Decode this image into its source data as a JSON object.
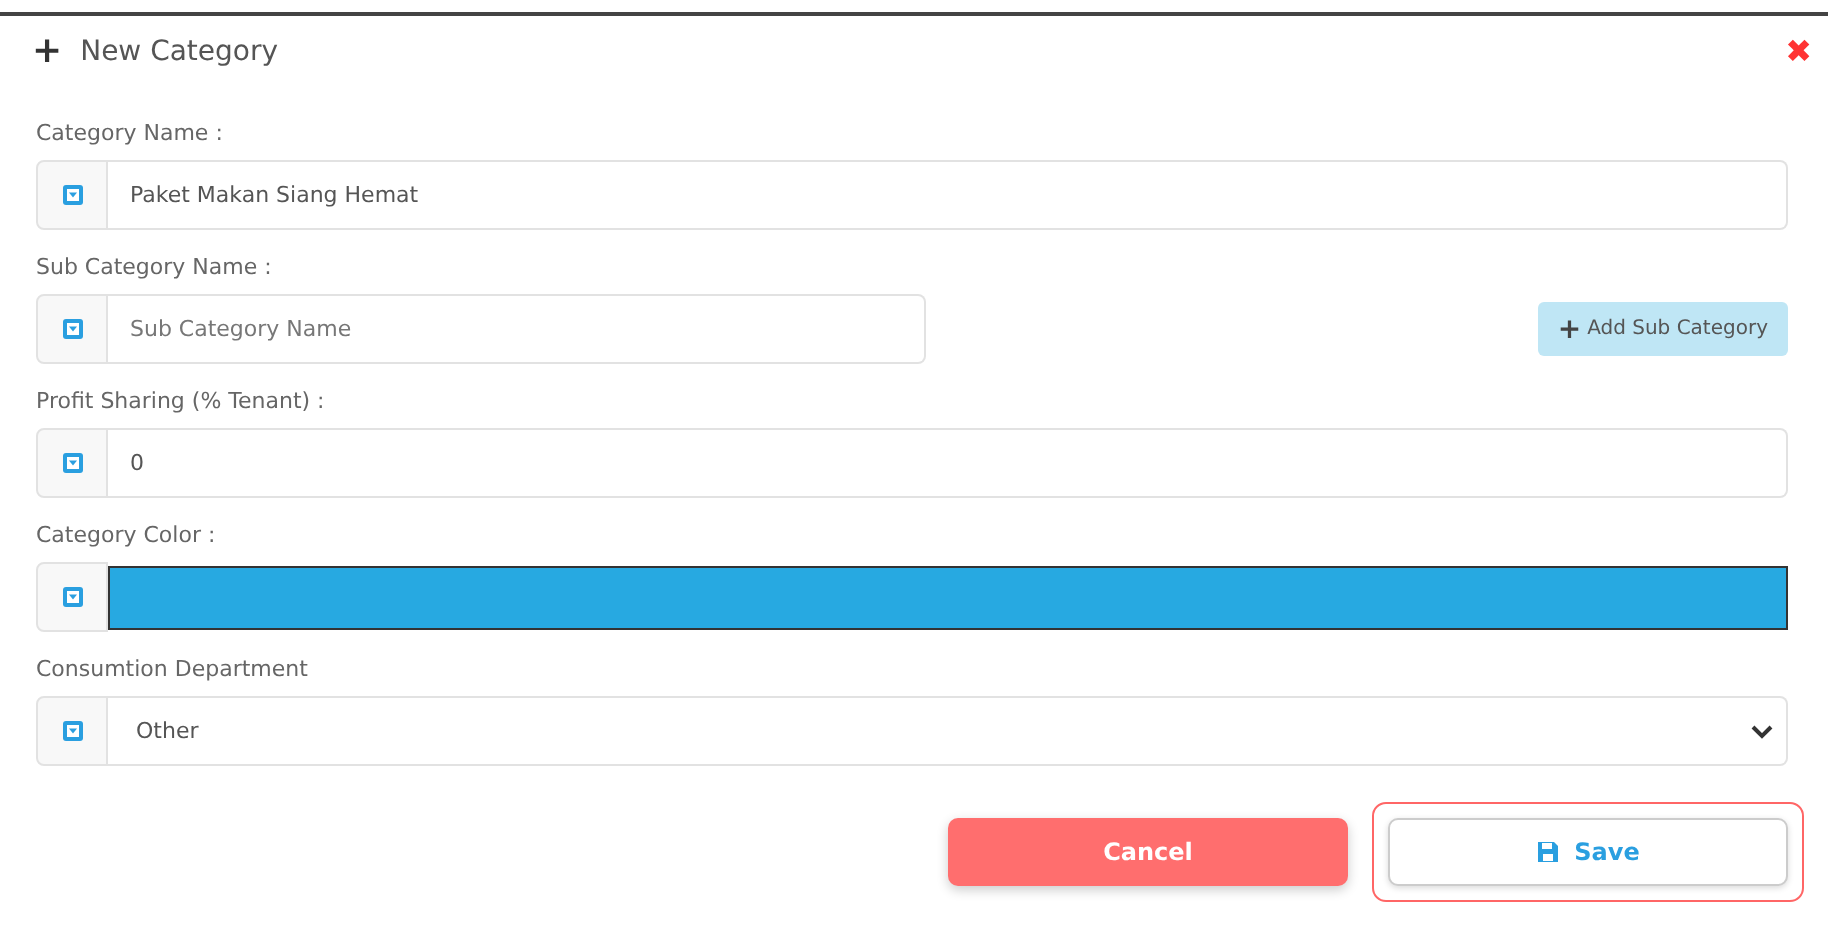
{
  "dialog": {
    "title": "New Category",
    "title_icon": "+",
    "close_icon": "✖"
  },
  "fields": [
    {
      "kind": "text",
      "label": "Category Name :",
      "value": "Paket Makan Siang Hemat"
    },
    {
      "kind": "text",
      "label": "Sub Category Name :",
      "placeholder": "Sub Category Name",
      "button": {
        "icon": "+",
        "label": "Add Sub Category"
      }
    },
    {
      "kind": "text",
      "label": "Profit Sharing (% Tenant) :",
      "value": "0"
    },
    {
      "kind": "color",
      "label": "Category Color :",
      "color": "#27a9e1"
    },
    {
      "kind": "select",
      "label": "Consumtion Department",
      "value": "Other"
    }
  ],
  "buttons": [
    {
      "kind": "cancel",
      "label": "Cancel",
      "focused": false
    },
    {
      "kind": "save",
      "label": "Save",
      "focused": true
    }
  ]
}
